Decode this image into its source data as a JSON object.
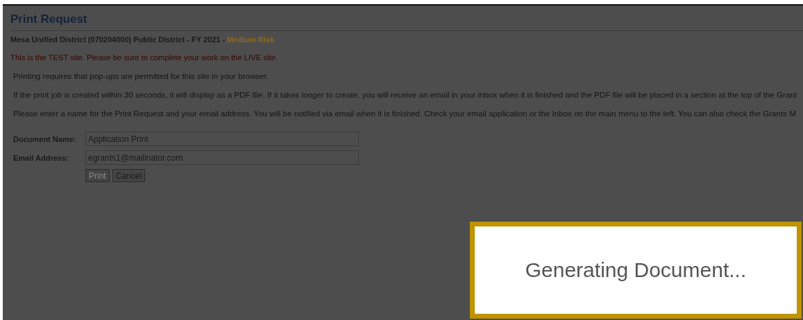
{
  "page": {
    "title": "Print Request"
  },
  "district": {
    "name": "Mesa Unified District (070204000) Public District - FY 2021 - ",
    "risk": "Medium Risk"
  },
  "warning": "This is the TEST site. Please be sure to complete your work on the LIVE site.",
  "paragraphs": [
    "Printing requires that pop-ups are permitted for this site in your browser.",
    "If the print job is created within 30 seconds, it will display as a PDF file. If it takes longer to create, you will receive an email in your inbox when it is finished and the PDF file will be placed in a section at the top of the Grant",
    "Please enter a name for the Print Request and your email address. You will be notified via email when it is finished. Check your email application or the Inbox on the main menu to the left. You can also check the Grants M"
  ],
  "form": {
    "fields": [
      {
        "label": "Document Name:",
        "value": "Application Print"
      },
      {
        "label": "Email Address:",
        "value": "egrants1@mailinator.com"
      }
    ],
    "buttons": [
      {
        "label": "Print",
        "disabled": true
      },
      {
        "label": "Cancel",
        "disabled": false
      }
    ]
  },
  "dialog": {
    "message": "Generating Document..."
  }
}
